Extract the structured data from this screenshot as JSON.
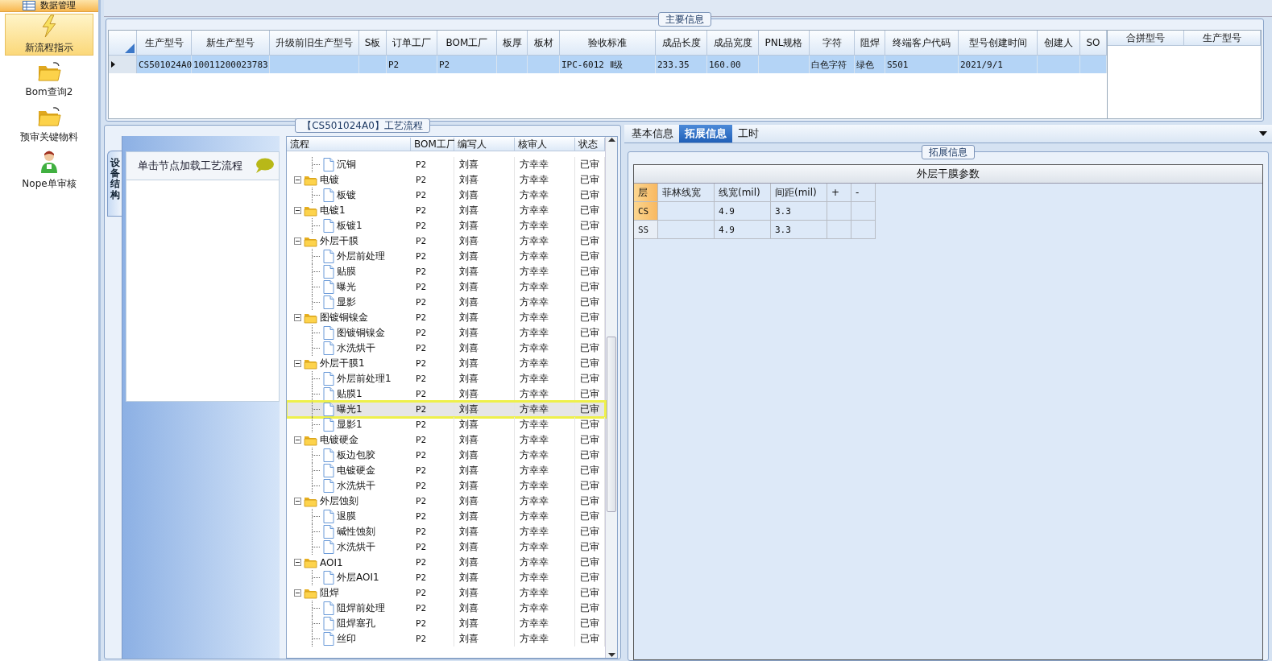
{
  "sidebar": {
    "header": "数据管理",
    "items": [
      {
        "label": "新流程指示",
        "kind": "bolt",
        "selected": true
      },
      {
        "label": "Bom查询2",
        "kind": "folder",
        "selected": false
      },
      {
        "label": "预审关键物料",
        "kind": "folder",
        "selected": false
      },
      {
        "label": "Nope单审核",
        "kind": "person",
        "selected": false
      }
    ]
  },
  "main_info": {
    "title": "主要信息",
    "columns": [
      "生产型号",
      "新生产型号",
      "升级前旧生产型号",
      "S板",
      "订单工厂",
      "BOM工厂",
      "板厚",
      "板材",
      "验收标准",
      "成品长度",
      "成品宽度",
      "PNL规格",
      "字符",
      "阻焊",
      "终端客户代码",
      "型号创建时间",
      "创建人",
      "SO"
    ],
    "rows": [
      {
        "selected": true,
        "cells": [
          "CS501024A0",
          "10011200023783",
          null,
          null,
          "P2",
          "P2",
          null,
          null,
          "IPC-6012 Ⅱ级",
          "233.35",
          "160.00",
          null,
          "白色字符",
          "绿色",
          "S501",
          "2021/9/1",
          null,
          null
        ]
      }
    ],
    "merge_columns": [
      "合拼型号",
      "生产型号"
    ]
  },
  "process": {
    "title": "【CS501024A0】工艺流程",
    "side_tab": "设备结构",
    "hint": "单击节点加载工艺流程",
    "columns": [
      "流程",
      "BOM工厂",
      "编写人",
      "核审人",
      "状态"
    ],
    "nodes": [
      {
        "children": [
          {
            "kind": "file",
            "label": "沉铜",
            "bom": "P2",
            "writer": "刘喜",
            "reviewer": "方幸幸",
            "status": "已审",
            "selected": false
          }
        ]
      },
      {
        "kind": "folder",
        "label": "电镀",
        "bom": "P2",
        "writer": "刘喜",
        "reviewer": "方幸幸",
        "status": "已审",
        "expanded": true,
        "selected": false,
        "children": [
          {
            "kind": "file",
            "label": "板镀",
            "bom": "P2",
            "writer": "刘喜",
            "reviewer": "方幸幸",
            "status": "已审",
            "selected": false
          }
        ]
      },
      {
        "kind": "folder",
        "label": "电镀1",
        "bom": "P2",
        "writer": "刘喜",
        "reviewer": "方幸幸",
        "status": "已审",
        "expanded": true,
        "selected": false,
        "children": [
          {
            "kind": "file",
            "label": "板镀1",
            "bom": "P2",
            "writer": "刘喜",
            "reviewer": "方幸幸",
            "status": "已审",
            "selected": false
          }
        ]
      },
      {
        "kind": "folder",
        "label": "外层干膜",
        "bom": "P2",
        "writer": "刘喜",
        "reviewer": "方幸幸",
        "status": "已审",
        "expanded": true,
        "selected": false,
        "children": [
          {
            "kind": "file",
            "label": "外层前处理",
            "bom": "P2",
            "writer": "刘喜",
            "reviewer": "方幸幸",
            "status": "已审",
            "selected": false
          },
          {
            "kind": "file",
            "label": "贴膜",
            "bom": "P2",
            "writer": "刘喜",
            "reviewer": "方幸幸",
            "status": "已审",
            "selected": false
          },
          {
            "kind": "file",
            "label": "曝光",
            "bom": "P2",
            "writer": "刘喜",
            "reviewer": "方幸幸",
            "status": "已审",
            "selected": false
          },
          {
            "kind": "file",
            "label": "显影",
            "bom": "P2",
            "writer": "刘喜",
            "reviewer": "方幸幸",
            "status": "已审",
            "selected": false
          }
        ]
      },
      {
        "kind": "folder",
        "label": "图镀铜镍金",
        "bom": "P2",
        "writer": "刘喜",
        "reviewer": "方幸幸",
        "status": "已审",
        "expanded": true,
        "selected": false,
        "children": [
          {
            "kind": "file",
            "label": "图镀铜镍金",
            "bom": "P2",
            "writer": "刘喜",
            "reviewer": "方幸幸",
            "status": "已审",
            "selected": false
          },
          {
            "kind": "file",
            "label": "水洗烘干",
            "bom": "P2",
            "writer": "刘喜",
            "reviewer": "方幸幸",
            "status": "已审",
            "selected": false
          }
        ]
      },
      {
        "kind": "folder",
        "label": "外层干膜1",
        "bom": "P2",
        "writer": "刘喜",
        "reviewer": "方幸幸",
        "status": "已审",
        "expanded": true,
        "selected": false,
        "children": [
          {
            "kind": "file",
            "label": "外层前处理1",
            "bom": "P2",
            "writer": "刘喜",
            "reviewer": "方幸幸",
            "status": "已审",
            "selected": false
          },
          {
            "kind": "file",
            "label": "贴膜1",
            "bom": "P2",
            "writer": "刘喜",
            "reviewer": "方幸幸",
            "status": "已审",
            "selected": false
          },
          {
            "kind": "file",
            "label": "曝光1",
            "bom": "P2",
            "writer": "刘喜",
            "reviewer": "方幸幸",
            "status": "已审",
            "selected": true
          },
          {
            "kind": "file",
            "label": "显影1",
            "bom": "P2",
            "writer": "刘喜",
            "reviewer": "方幸幸",
            "status": "已审",
            "selected": false
          }
        ]
      },
      {
        "kind": "folder",
        "label": "电镀硬金",
        "bom": "P2",
        "writer": "刘喜",
        "reviewer": "方幸幸",
        "status": "已审",
        "expanded": true,
        "selected": false,
        "children": [
          {
            "kind": "file",
            "label": "板边包胶",
            "bom": "P2",
            "writer": "刘喜",
            "reviewer": "方幸幸",
            "status": "已审",
            "selected": false
          },
          {
            "kind": "file",
            "label": "电镀硬金",
            "bom": "P2",
            "writer": "刘喜",
            "reviewer": "方幸幸",
            "status": "已审",
            "selected": false
          },
          {
            "kind": "file",
            "label": "水洗烘干",
            "bom": "P2",
            "writer": "刘喜",
            "reviewer": "方幸幸",
            "status": "已审",
            "selected": false
          }
        ]
      },
      {
        "kind": "folder",
        "label": "外层蚀刻",
        "bom": "P2",
        "writer": "刘喜",
        "reviewer": "方幸幸",
        "status": "已审",
        "expanded": true,
        "selected": false,
        "children": [
          {
            "kind": "file",
            "label": "退膜",
            "bom": "P2",
            "writer": "刘喜",
            "reviewer": "方幸幸",
            "status": "已审",
            "selected": false
          },
          {
            "kind": "file",
            "label": "碱性蚀刻",
            "bom": "P2",
            "writer": "刘喜",
            "reviewer": "方幸幸",
            "status": "已审",
            "selected": false
          },
          {
            "kind": "file",
            "label": "水洗烘干",
            "bom": "P2",
            "writer": "刘喜",
            "reviewer": "方幸幸",
            "status": "已审",
            "selected": false
          }
        ]
      },
      {
        "kind": "folder",
        "label": "AOI1",
        "bom": "P2",
        "writer": "刘喜",
        "reviewer": "方幸幸",
        "status": "已审",
        "expanded": true,
        "selected": false,
        "children": [
          {
            "kind": "file",
            "label": "外层AOI1",
            "bom": "P2",
            "writer": "刘喜",
            "reviewer": "方幸幸",
            "status": "已审",
            "selected": false
          }
        ]
      },
      {
        "kind": "folder",
        "label": "阻焊",
        "bom": "P2",
        "writer": "刘喜",
        "reviewer": "方幸幸",
        "status": "已审",
        "expanded": true,
        "selected": false,
        "children": [
          {
            "kind": "file",
            "label": "阻焊前处理",
            "bom": "P2",
            "writer": "刘喜",
            "reviewer": "方幸幸",
            "status": "已审",
            "selected": false
          },
          {
            "kind": "file",
            "label": "阻焊塞孔",
            "bom": "P2",
            "writer": "刘喜",
            "reviewer": "方幸幸",
            "status": "已审",
            "selected": false
          },
          {
            "kind": "file",
            "label": "丝印",
            "bom": "P2",
            "writer": "刘喜",
            "reviewer": "方幸幸",
            "status": "已审",
            "selected": false
          }
        ]
      }
    ]
  },
  "detail": {
    "tabs": [
      {
        "label": "基本信息",
        "selected": false
      },
      {
        "label": "拓展信息",
        "selected": true
      },
      {
        "label": "工时",
        "selected": false
      }
    ],
    "group_title": "拓展信息",
    "table_title": "外层干膜参数",
    "columns": [
      "层",
      "菲林线宽",
      "线宽(mil)",
      "间距(mil)",
      "+",
      "-"
    ],
    "rows": [
      {
        "selected": true,
        "cells": [
          "CS",
          null,
          "4.9",
          "3.3",
          null,
          null
        ]
      },
      {
        "selected": false,
        "cells": [
          "SS",
          null,
          "4.9",
          "3.3",
          null,
          null
        ]
      }
    ]
  }
}
